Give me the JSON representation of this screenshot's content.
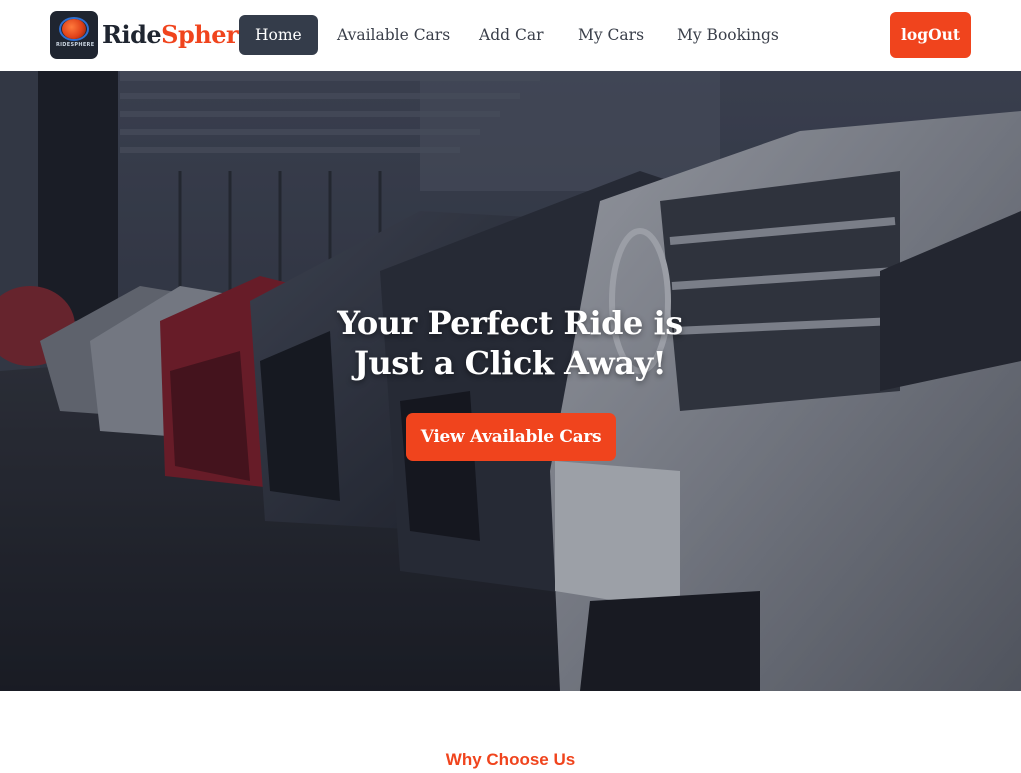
{
  "brand": {
    "part1": "Ride",
    "part2": "Sphere",
    "logo_text": "RIDESPHERE"
  },
  "nav": {
    "items": [
      {
        "label": "Home",
        "active": true
      },
      {
        "label": "Available Cars",
        "active": false
      },
      {
        "label": "Add Car",
        "active": false
      },
      {
        "label": "My Cars",
        "active": false
      },
      {
        "label": "My Bookings",
        "active": false
      }
    ],
    "logout_label": "logOut"
  },
  "hero": {
    "title_line1": "Your Perfect Ride is",
    "title_line2": "Just a Click Away!",
    "cta_label": "View Available Cars"
  },
  "section": {
    "heading": "Why Choose Us"
  },
  "colors": {
    "accent": "#f0441d",
    "nav_active_bg": "#343c4a",
    "brand_dark": "#1f2530"
  }
}
